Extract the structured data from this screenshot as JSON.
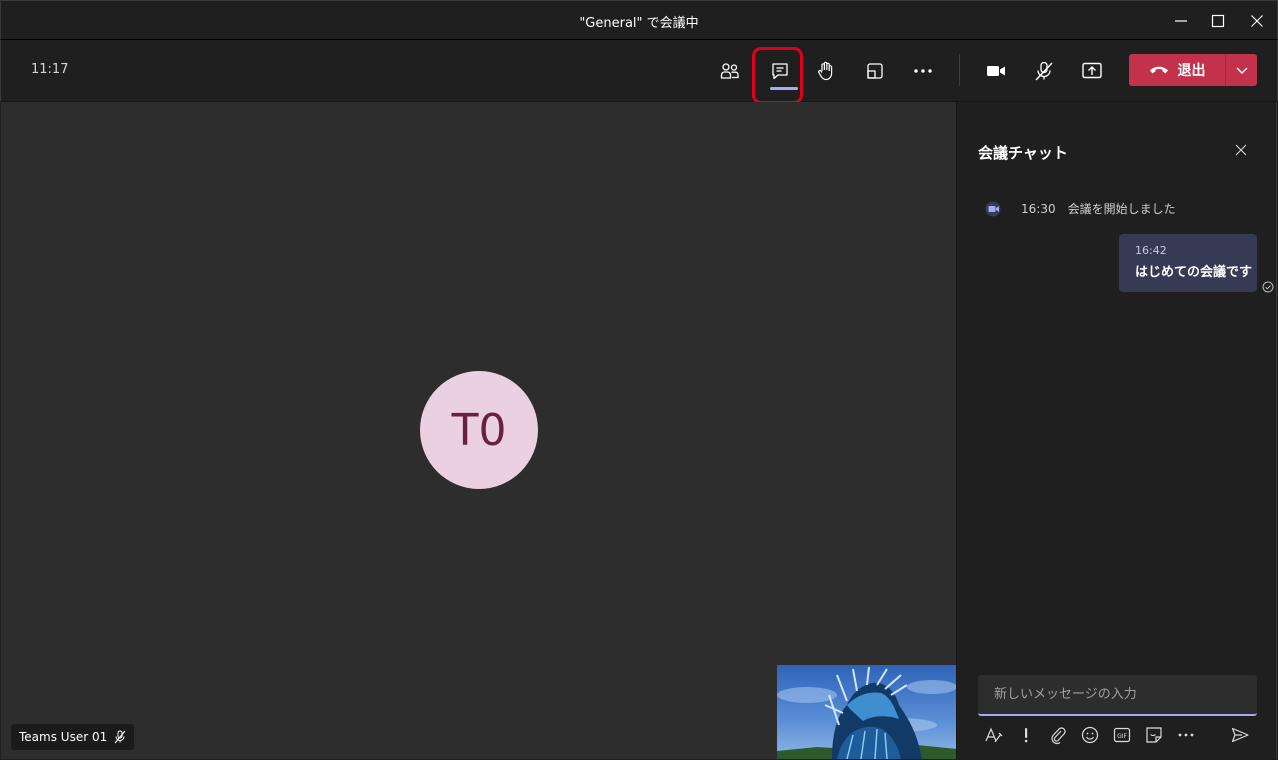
{
  "window": {
    "title": "\"General\" で会議中"
  },
  "toolbar": {
    "clock": "11:17",
    "leave_label": "退出",
    "buttons": [
      {
        "name": "people",
        "icon": "people-icon"
      },
      {
        "name": "chat",
        "icon": "chat-icon",
        "active": true
      },
      {
        "name": "raise-hand",
        "icon": "hand-icon"
      },
      {
        "name": "breakout-rooms",
        "icon": "rooms-icon"
      },
      {
        "name": "more-actions",
        "icon": "more-icon"
      },
      {
        "name": "camera",
        "icon": "camera-icon"
      },
      {
        "name": "mic",
        "icon": "mic-off-icon"
      },
      {
        "name": "share",
        "icon": "share-icon"
      }
    ]
  },
  "stage": {
    "avatar_initials": "T0",
    "participant_name": "Teams User 01"
  },
  "chat": {
    "title": "会議チャット",
    "system_message": {
      "time": "16:30",
      "text": "会議を開始しました"
    },
    "messages": [
      {
        "time": "16:42",
        "text": "はじめての会議です"
      }
    ],
    "compose_placeholder": "新しいメッセージの入力"
  },
  "colors": {
    "background": "#1f1f1f",
    "stage": "#2d2d2d",
    "leave_button": "#c4314b",
    "accent": "#a9aaf5",
    "avatar_bg": "#ebd0e2",
    "avatar_text": "#68223f",
    "highlight_outline": "#e0001b",
    "bubble": "#373a55"
  }
}
